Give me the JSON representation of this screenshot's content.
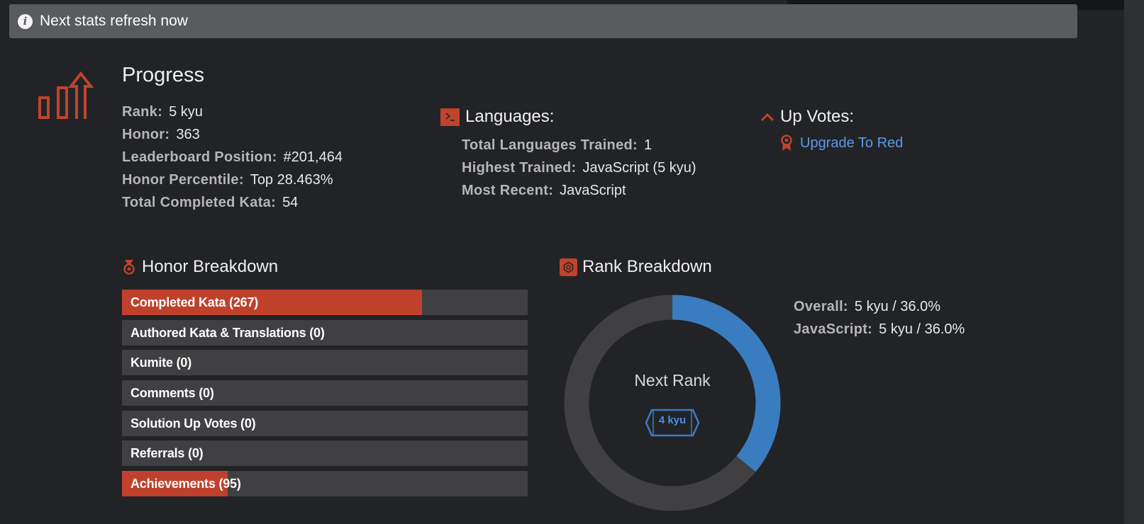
{
  "notice": {
    "text": "Next stats refresh now"
  },
  "progress": {
    "title": "Progress",
    "stats": [
      {
        "label": "Rank:",
        "value": "5 kyu"
      },
      {
        "label": "Honor:",
        "value": "363"
      },
      {
        "label": "Leaderboard Position:",
        "value": "#201,464"
      },
      {
        "label": "Honor Percentile:",
        "value": "Top 28.463%"
      },
      {
        "label": "Total Completed Kata:",
        "value": "54"
      }
    ]
  },
  "languages": {
    "title": "Languages:",
    "stats": [
      {
        "label": "Total Languages Trained:",
        "value": "1"
      },
      {
        "label": "Highest Trained:",
        "value": "JavaScript (5 kyu)"
      },
      {
        "label": "Most Recent:",
        "value": "JavaScript"
      }
    ]
  },
  "upvotes": {
    "title": "Up Votes:",
    "link": "Upgrade To Red"
  },
  "honor_breakdown": {
    "title": "Honor Breakdown",
    "items": [
      {
        "label": "Completed Kata (267)",
        "fill": 0.74
      },
      {
        "label": "Authored Kata & Translations (0)",
        "fill": 0
      },
      {
        "label": "Kumite (0)",
        "fill": 0
      },
      {
        "label": "Comments (0)",
        "fill": 0
      },
      {
        "label": "Solution Up Votes (0)",
        "fill": 0
      },
      {
        "label": "Referrals (0)",
        "fill": 0
      },
      {
        "label": "Achievements (95)",
        "fill": 0.26
      }
    ]
  },
  "rank_breakdown": {
    "title": "Rank Breakdown",
    "next_rank_label": "Next Rank",
    "next_rank_badge": "4 kyu",
    "progress_fraction": 0.36,
    "stats": [
      {
        "label": "Overall:",
        "value": "5 kyu / 36.0%"
      },
      {
        "label": "JavaScript:",
        "value": "5 kyu / 36.0%"
      }
    ]
  },
  "colors": {
    "accent_red": "#bf412c",
    "accent_blue": "#3a7cc0",
    "link_blue": "#5d9ae6",
    "background": "#222327"
  },
  "icons": {
    "info": "info-icon",
    "progress": "bar-chart-arrow-icon",
    "languages": "terminal-icon",
    "upvotes": "chevron-up-icon",
    "upgrade": "ribbon-icon",
    "honor": "medal-icon",
    "rank": "hexagon-icon"
  }
}
